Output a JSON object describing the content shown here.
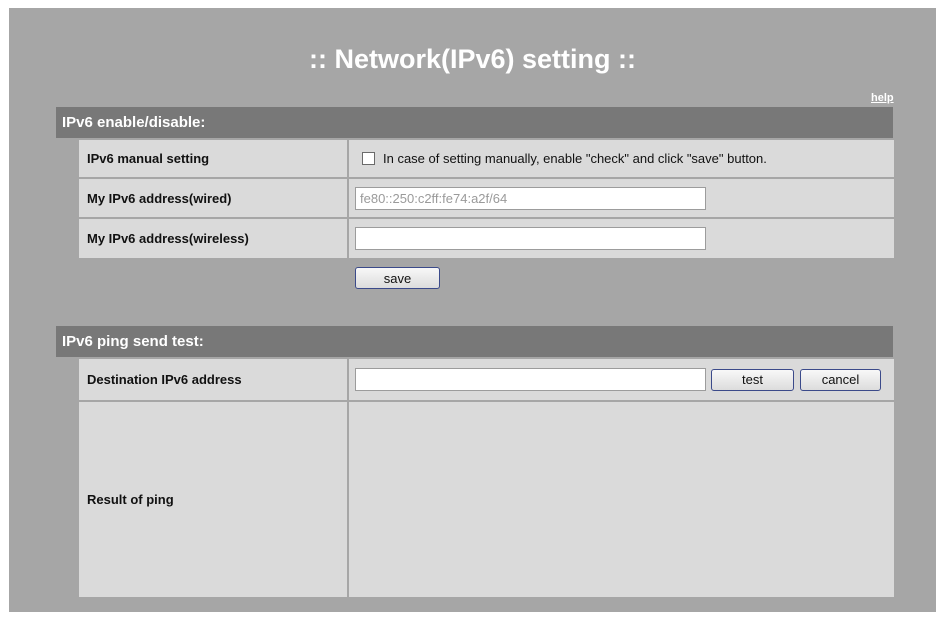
{
  "page": {
    "title": ":: Network(IPv6) setting ::",
    "help_link": "help"
  },
  "section_enable": {
    "header": "IPv6 enable/disable:",
    "rows": [
      {
        "label": "IPv6 manual setting",
        "note": "In case of setting manually, enable \"check\" and click \"save\" button.",
        "checked": false
      },
      {
        "label": "My IPv6 address(wired)",
        "value": "fe80::250:c2ff:fe74:a2f/64"
      },
      {
        "label": "My IPv6 address(wireless)",
        "value": ""
      }
    ],
    "save_label": "save"
  },
  "section_ping": {
    "header": "IPv6 ping send test:",
    "dest_label": "Destination IPv6 address",
    "dest_value": "",
    "test_label": "test",
    "cancel_label": "cancel",
    "result_label": "Result of ping",
    "result_text": ""
  }
}
